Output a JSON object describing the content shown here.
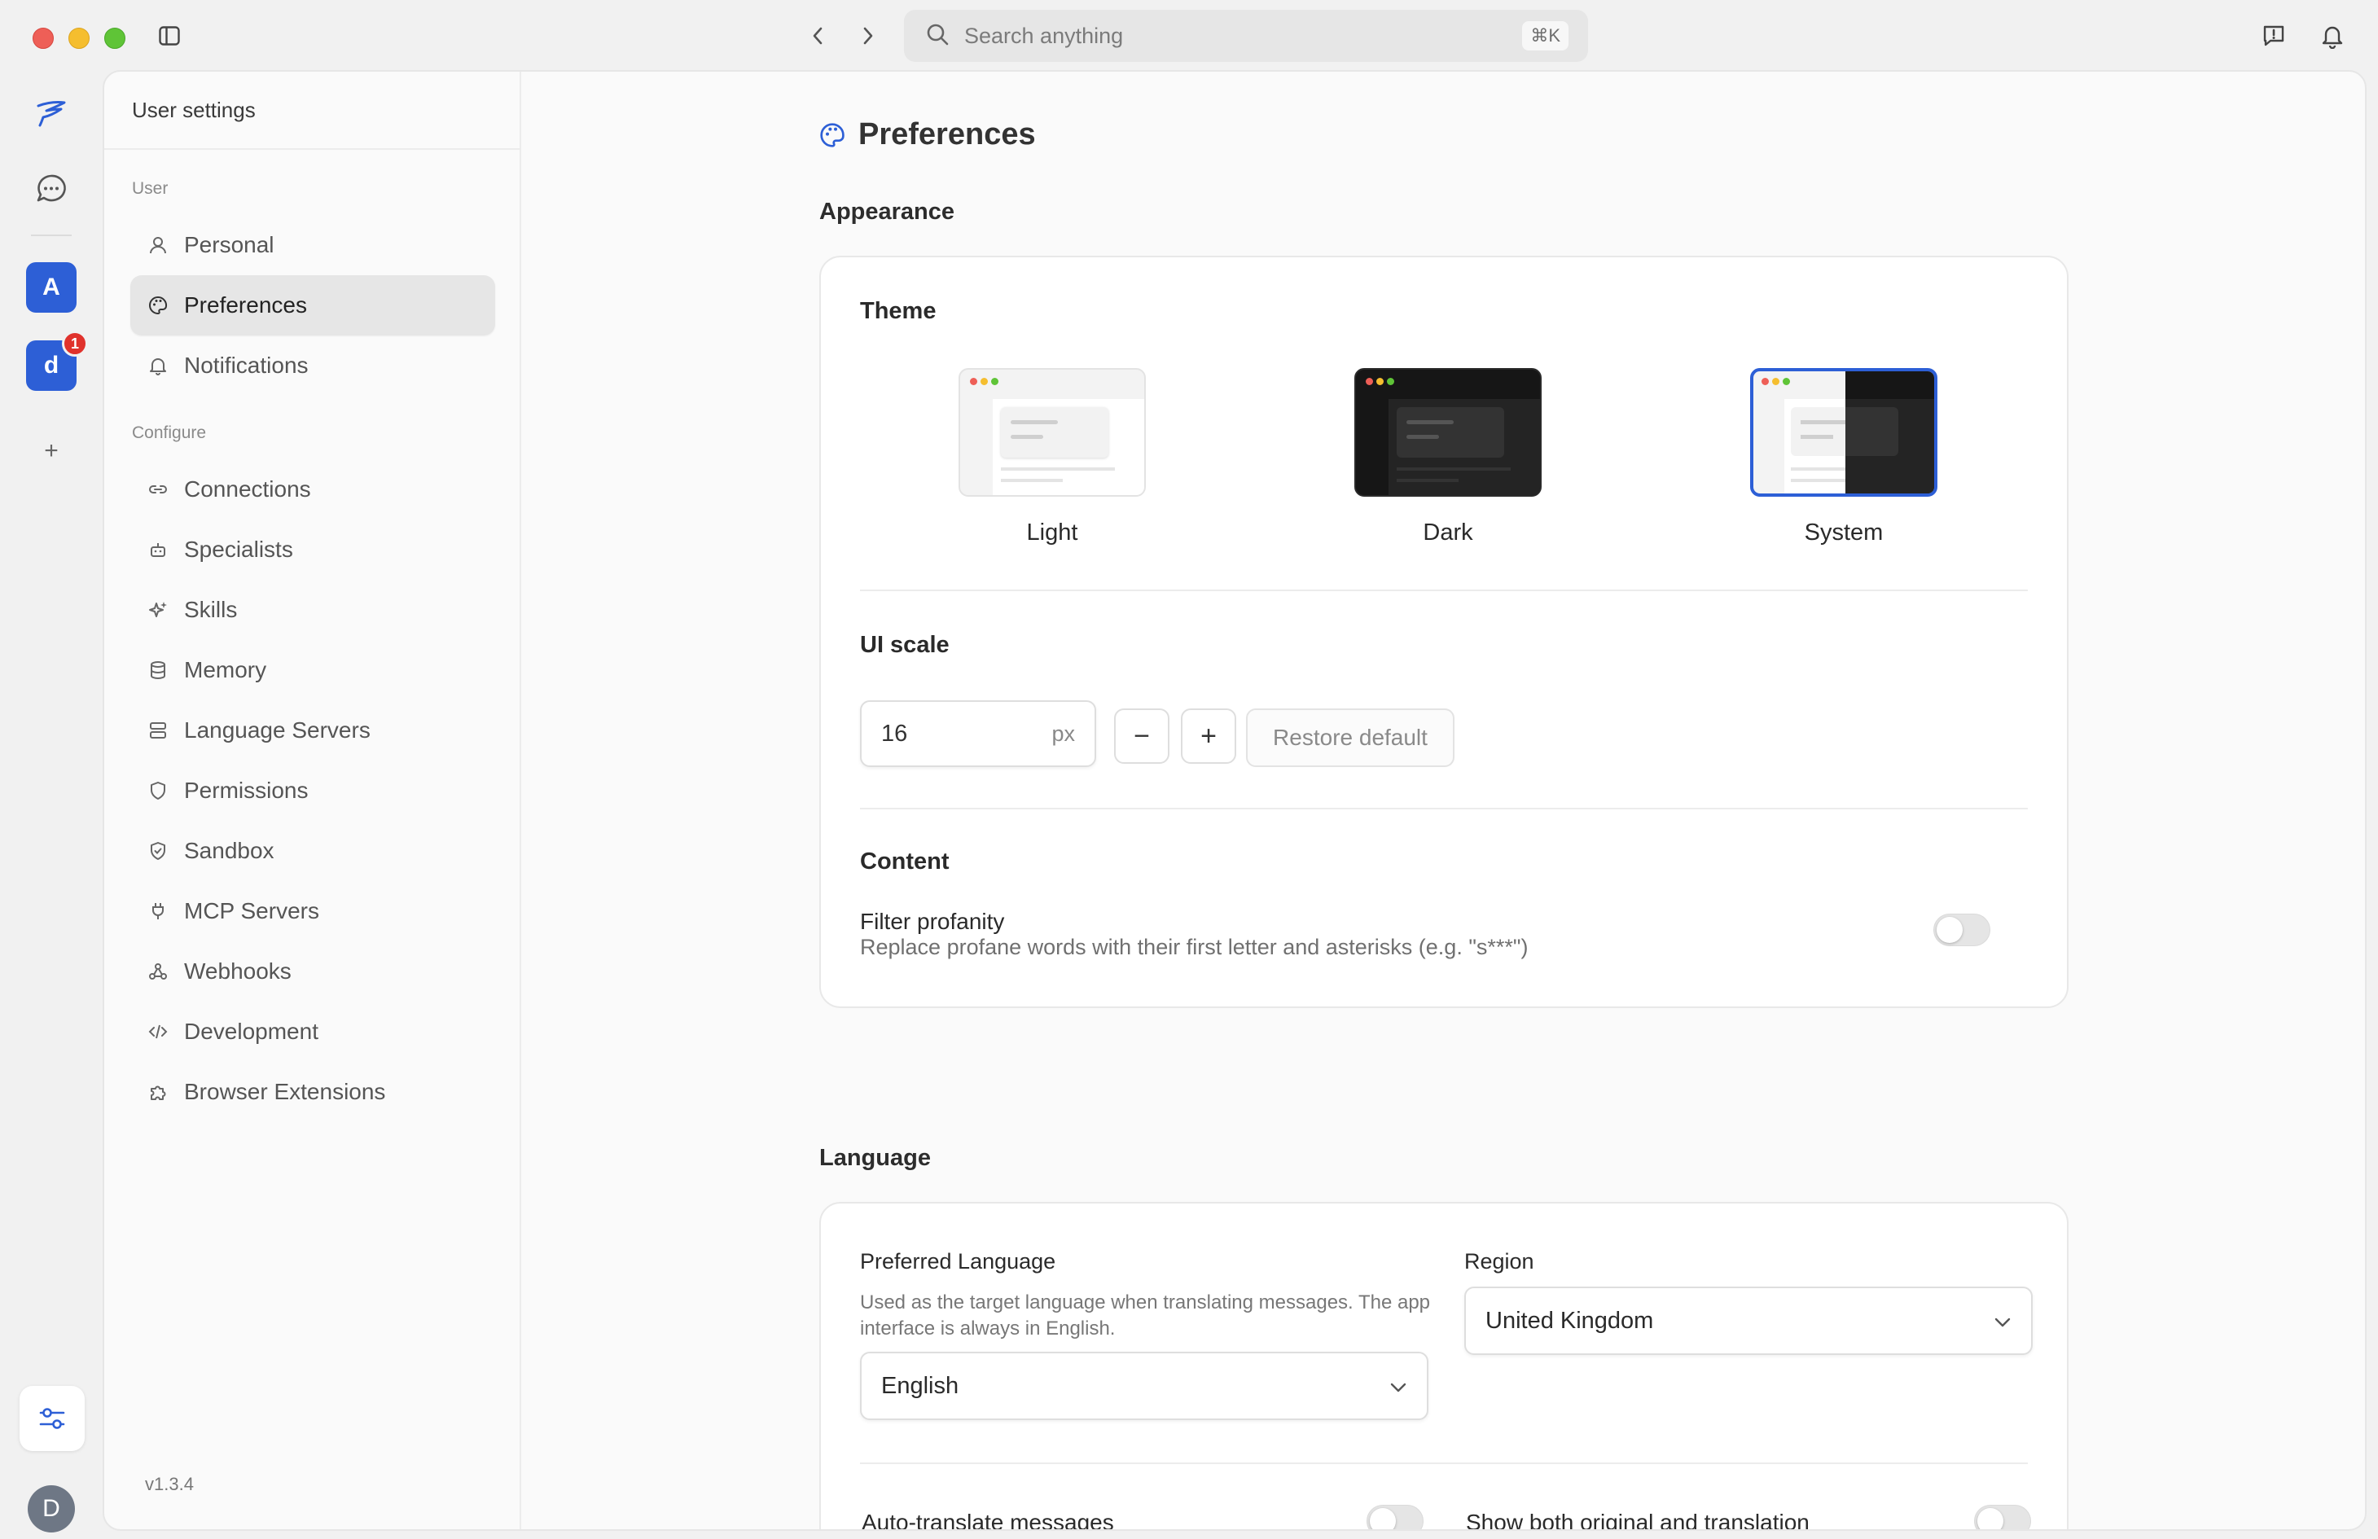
{
  "titlebar": {
    "search_placeholder": "Search anything",
    "search_shortcut": "⌘K",
    "icons": [
      "sidebar-toggle-icon",
      "chevron-left-icon",
      "chevron-right-icon",
      "search-icon",
      "feedback-icon",
      "bell-icon"
    ]
  },
  "rail": {
    "workspaces": [
      {
        "letter": "A",
        "badge": ""
      },
      {
        "letter": "d",
        "badge": "1"
      }
    ],
    "add_label": "+",
    "avatar_letter": "D",
    "accent": "#2d5fd6"
  },
  "settings_nav": {
    "title": "User settings",
    "section_user": "User",
    "section_configure": "Configure",
    "user_items": [
      {
        "label": "Personal",
        "icon": "user-icon"
      },
      {
        "label": "Preferences",
        "icon": "palette-icon",
        "active": true
      },
      {
        "label": "Notifications",
        "icon": "bell-icon"
      }
    ],
    "configure_items": [
      {
        "label": "Connections",
        "icon": "link-icon"
      },
      {
        "label": "Specialists",
        "icon": "bot-icon"
      },
      {
        "label": "Skills",
        "icon": "sparkles-icon"
      },
      {
        "label": "Memory",
        "icon": "database-icon"
      },
      {
        "label": "Language Servers",
        "icon": "server-icon"
      },
      {
        "label": "Permissions",
        "icon": "shield-icon"
      },
      {
        "label": "Sandbox",
        "icon": "shield-check-icon"
      },
      {
        "label": "MCP Servers",
        "icon": "plug-icon"
      },
      {
        "label": "Webhooks",
        "icon": "webhook-icon"
      },
      {
        "label": "Development",
        "icon": "code-icon"
      },
      {
        "label": "Browser Extensions",
        "icon": "puzzle-icon"
      }
    ],
    "version": "v1.3.4"
  },
  "main": {
    "page_title": "Preferences",
    "appearance": {
      "section_title": "Appearance",
      "theme_label": "Theme",
      "themes": [
        {
          "name": "Light",
          "selected": false
        },
        {
          "name": "Dark",
          "selected": false
        },
        {
          "name": "System",
          "selected": true
        }
      ],
      "ui_scale_label": "UI scale",
      "ui_scale_value": "16",
      "ui_scale_unit": "px",
      "minus": "−",
      "plus": "+",
      "restore_default": "Restore default",
      "content_label": "Content",
      "filter_profanity_title": "Filter profanity",
      "filter_profanity_desc": "Replace profane words with their first letter and asterisks (e.g. \"s***\")",
      "filter_profanity_on": false
    },
    "language": {
      "section_title": "Language",
      "preferred_label": "Preferred Language",
      "preferred_help": "Used as the target language when translating messages. The app interface is always in English.",
      "preferred_value": "English",
      "region_label": "Region",
      "region_value": "United Kingdom",
      "auto_translate_label": "Auto-translate messages",
      "auto_translate_on": false,
      "show_both_label": "Show both original and translation",
      "show_both_on": false
    }
  }
}
